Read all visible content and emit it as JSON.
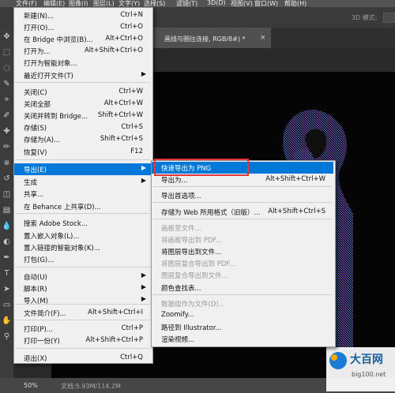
{
  "menubar": {
    "items": [
      "文件(F)",
      "编辑(E)",
      "图像(I)",
      "图层(L)",
      "文字(Y)",
      "选择(S)",
      "滤镜(T)",
      "3D(D)",
      "视图(V)",
      "窗口(W)",
      "帮助(H)"
    ]
  },
  "optbar": {
    "mode_label": "3D 模式:"
  },
  "document": {
    "tab_title": "画线与圈往连接, RGB/8#) *",
    "close_glyph": "×"
  },
  "status": {
    "zoom": "50%",
    "doc_info": "文档:5.93M/114.2M"
  },
  "file_menu": {
    "items": [
      {
        "label": "新建(N)...",
        "shortcut": "Ctrl+N"
      },
      {
        "label": "打开(O)...",
        "shortcut": "Ctrl+O"
      },
      {
        "label": "在 Bridge 中浏览(B)...",
        "shortcut": "Alt+Ctrl+O"
      },
      {
        "label": "打开为...",
        "shortcut": "Alt+Shift+Ctrl+O"
      },
      {
        "label": "打开为智能对象...",
        "shortcut": ""
      },
      {
        "label": "最近打开文件(T)",
        "shortcut": "",
        "submenu": true
      },
      {
        "label": "关闭(C)",
        "shortcut": "Ctrl+W"
      },
      {
        "label": "关闭全部",
        "shortcut": "Alt+Ctrl+W"
      },
      {
        "label": "关闭并转到 Bridge...",
        "shortcut": "Shift+Ctrl+W"
      },
      {
        "label": "存储(S)",
        "shortcut": "Ctrl+S"
      },
      {
        "label": "存储为(A)...",
        "shortcut": "Shift+Ctrl+S"
      },
      {
        "label": "恢复(V)",
        "shortcut": "F12"
      },
      {
        "label": "导出(E)",
        "shortcut": "",
        "submenu": true,
        "highlighted": true
      },
      {
        "label": "生成",
        "shortcut": "",
        "submenu": true
      },
      {
        "label": "共享...",
        "shortcut": ""
      },
      {
        "label": "在 Behance 上共享(D)...",
        "shortcut": ""
      },
      {
        "label": "搜索 Adobe Stock...",
        "shortcut": ""
      },
      {
        "label": "置入嵌入对象(L)...",
        "shortcut": ""
      },
      {
        "label": "置入链接的智能对象(K)...",
        "shortcut": ""
      },
      {
        "label": "打包(G)...",
        "shortcut": ""
      },
      {
        "label": "自动(U)",
        "shortcut": "",
        "submenu": true
      },
      {
        "label": "脚本(R)",
        "shortcut": "",
        "submenu": true
      },
      {
        "label": "导入(M)",
        "shortcut": "",
        "submenu": true
      },
      {
        "label": "文件简介(F)...",
        "shortcut": "Alt+Shift+Ctrl+I"
      },
      {
        "label": "打印(P)...",
        "shortcut": "Ctrl+P"
      },
      {
        "label": "打印一份(Y)",
        "shortcut": "Alt+Shift+Ctrl+P"
      },
      {
        "label": "退出(X)",
        "shortcut": "Ctrl+Q"
      }
    ]
  },
  "export_menu": {
    "items": [
      {
        "label": "快速导出为 PNG",
        "shortcut": "",
        "highlighted": true
      },
      {
        "label": "导出为...",
        "shortcut": "Alt+Shift+Ctrl+W"
      },
      {
        "label": "导出首选项...",
        "shortcut": ""
      },
      {
        "label": "存储为 Web 所用格式（旧版）...",
        "shortcut": "Alt+Shift+Ctrl+S"
      },
      {
        "label": "画板至文件...",
        "shortcut": "",
        "disabled": true
      },
      {
        "label": "将画板导出到 PDF...",
        "shortcut": "",
        "disabled": true
      },
      {
        "label": "将图层导出到文件...",
        "shortcut": ""
      },
      {
        "label": "将图层复合导出到 PDF...",
        "shortcut": "",
        "disabled": true
      },
      {
        "label": "图层复合导出到文件...",
        "shortcut": "",
        "disabled": true
      },
      {
        "label": "颜色查找表...",
        "shortcut": ""
      },
      {
        "label": "数据组作为文件(D)...",
        "shortcut": "",
        "disabled": true
      },
      {
        "label": "Zoomify...",
        "shortcut": ""
      },
      {
        "label": "路径到 Illustrator...",
        "shortcut": ""
      },
      {
        "label": "渲染视频...",
        "shortcut": ""
      }
    ]
  },
  "watermark": {
    "title": "大百网",
    "url": "big100.net"
  },
  "colors": {
    "highlight": "#0078d7",
    "annotation_box": "#e0363c"
  },
  "icons": {
    "submenu_arrow": "chevron-right-icon",
    "tools": [
      "move-icon",
      "marquee-icon",
      "lasso-icon",
      "quick-select-icon",
      "crop-icon",
      "eyedropper-icon",
      "healing-icon",
      "brush-icon",
      "stamp-icon",
      "history-brush-icon",
      "eraser-icon",
      "gradient-icon",
      "blur-icon",
      "dodge-icon",
      "pen-icon",
      "type-icon",
      "path-select-icon",
      "rectangle-icon",
      "hand-icon",
      "zoom-icon"
    ]
  }
}
